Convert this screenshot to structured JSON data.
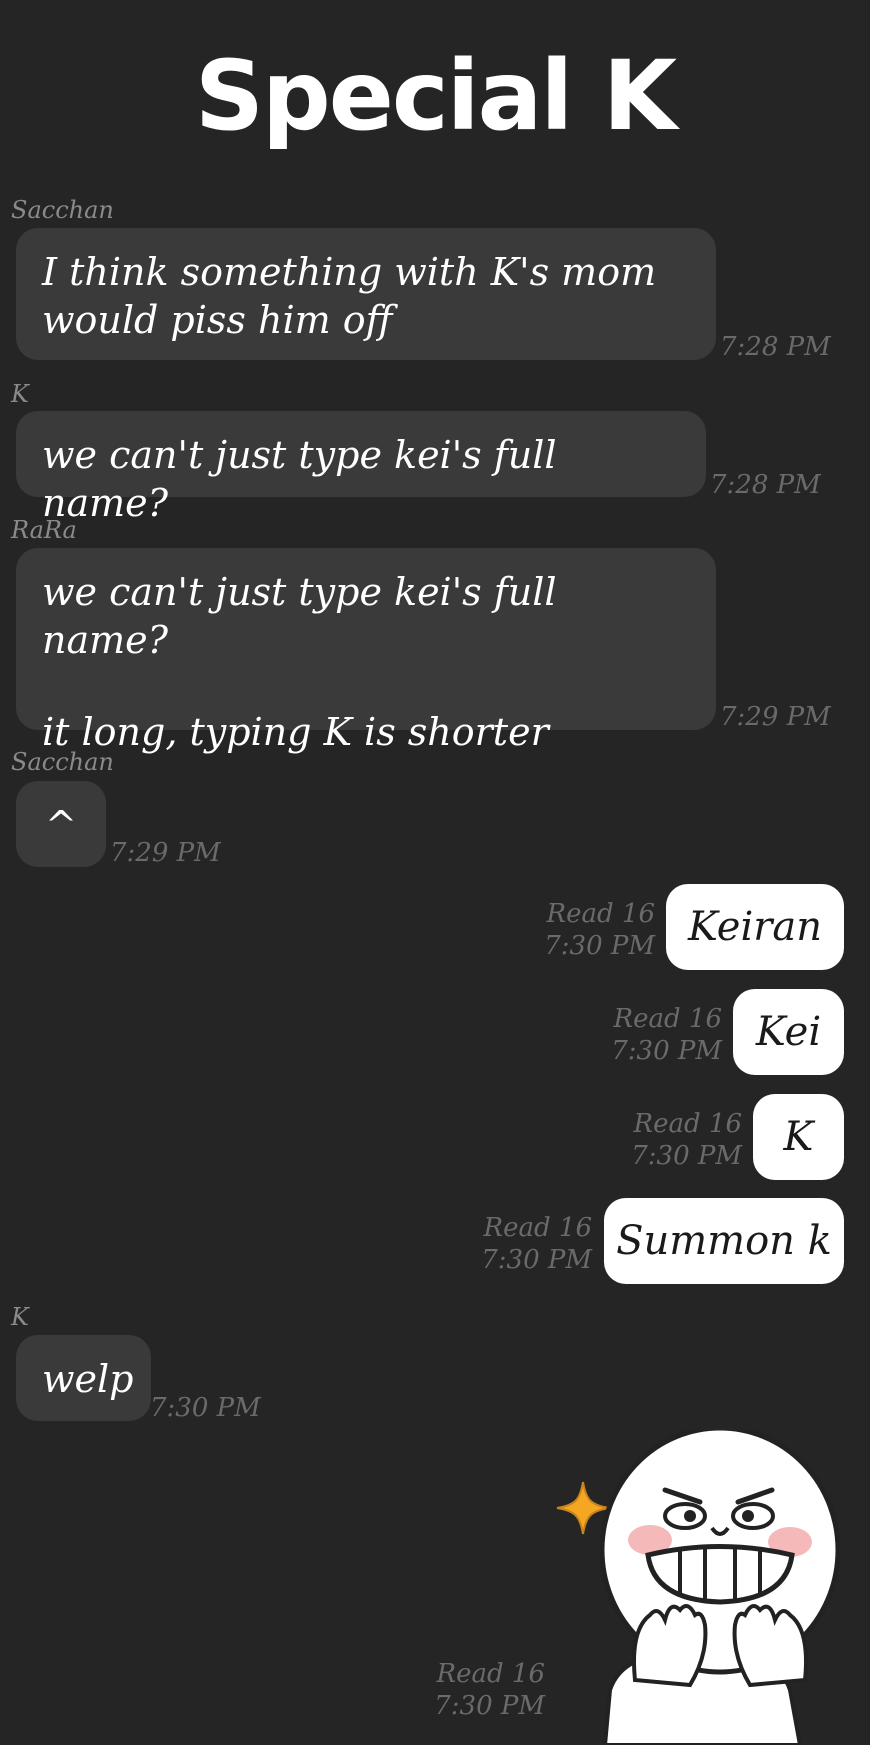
{
  "header": {
    "title": "Special K"
  },
  "messages": [
    {
      "sender": "Sacchan",
      "text_lines": [
        "I think something with K's mom",
        "would piss him off"
      ],
      "time": "7:28 PM"
    },
    {
      "sender": "K",
      "text_lines": [
        "we can't just type kei's full name?"
      ],
      "time": "7:28 PM"
    },
    {
      "sender": "RaRa",
      "text_lines": [
        "we can't just type kei's full name?",
        "",
        "it long, typing K is shorter"
      ],
      "time": "7:29 PM"
    },
    {
      "sender": "Sacchan",
      "text_lines": [
        "^"
      ],
      "time": "7:29 PM"
    },
    {
      "outgoing": true,
      "text": "Keiran",
      "read": "Read 16",
      "time": "7:30 PM"
    },
    {
      "outgoing": true,
      "text": "Kei",
      "read": "Read 16",
      "time": "7:30 PM"
    },
    {
      "outgoing": true,
      "text": "K",
      "read": "Read 16",
      "time": "7:30 PM"
    },
    {
      "outgoing": true,
      "text": "Summon k",
      "read": "Read 16",
      "time": "7:30 PM"
    },
    {
      "sender": "K",
      "text_lines": [
        "welp"
      ],
      "time": "7:30 PM"
    },
    {
      "outgoing": true,
      "sticker": "grinning-moon-sticker",
      "read": "Read 16",
      "time": "7:30 PM"
    }
  ],
  "colors": {
    "background": "#252525",
    "incoming_bubble": "#3a3a3a",
    "outgoing_bubble": "#ffffff",
    "meta_text": "#6a6a6a",
    "sparkle": "#f5a623"
  }
}
